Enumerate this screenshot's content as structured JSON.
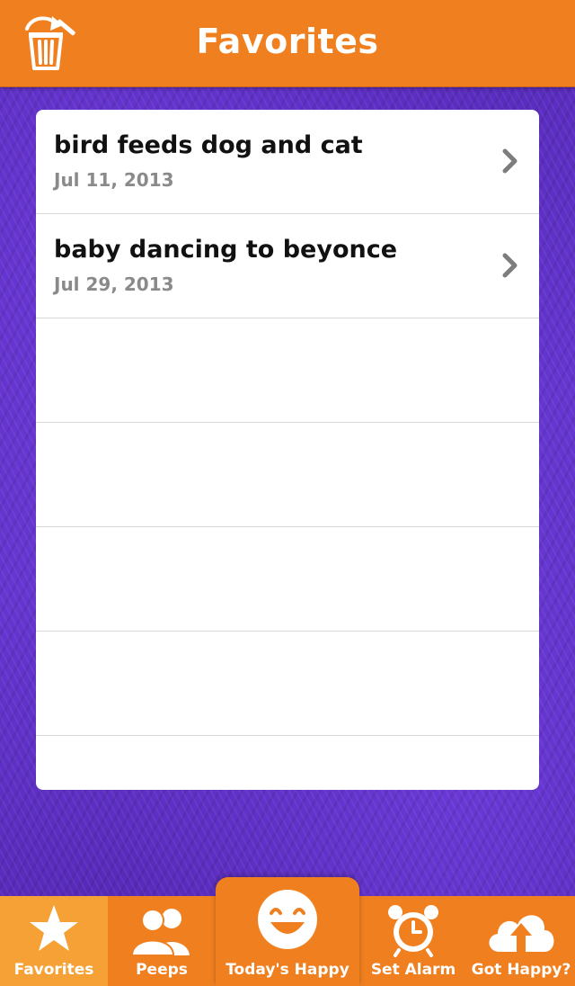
{
  "header": {
    "title": "Favorites",
    "clear_icon": "trash-undo-icon"
  },
  "favorites": [
    {
      "title": "bird feeds dog and cat",
      "date": "Jul 11, 2013"
    },
    {
      "title": "baby dancing to beyonce",
      "date": "Jul 29, 2013"
    }
  ],
  "tabs": [
    {
      "label": "Favorites",
      "icon": "star-icon",
      "selected": true
    },
    {
      "label": "Peeps",
      "icon": "people-icon",
      "selected": false
    },
    {
      "label": "Today's Happy",
      "icon": "smiley-icon",
      "selected": false
    },
    {
      "label": "Set Alarm",
      "icon": "alarm-clock-icon",
      "selected": false
    },
    {
      "label": "Got Happy?",
      "icon": "cloud-upload-icon",
      "selected": false
    }
  ],
  "colors": {
    "accent": "#f07f1f",
    "selected_tab": "#f5a135",
    "background": "#5b2cc0",
    "date_text": "#8a8a8a"
  }
}
